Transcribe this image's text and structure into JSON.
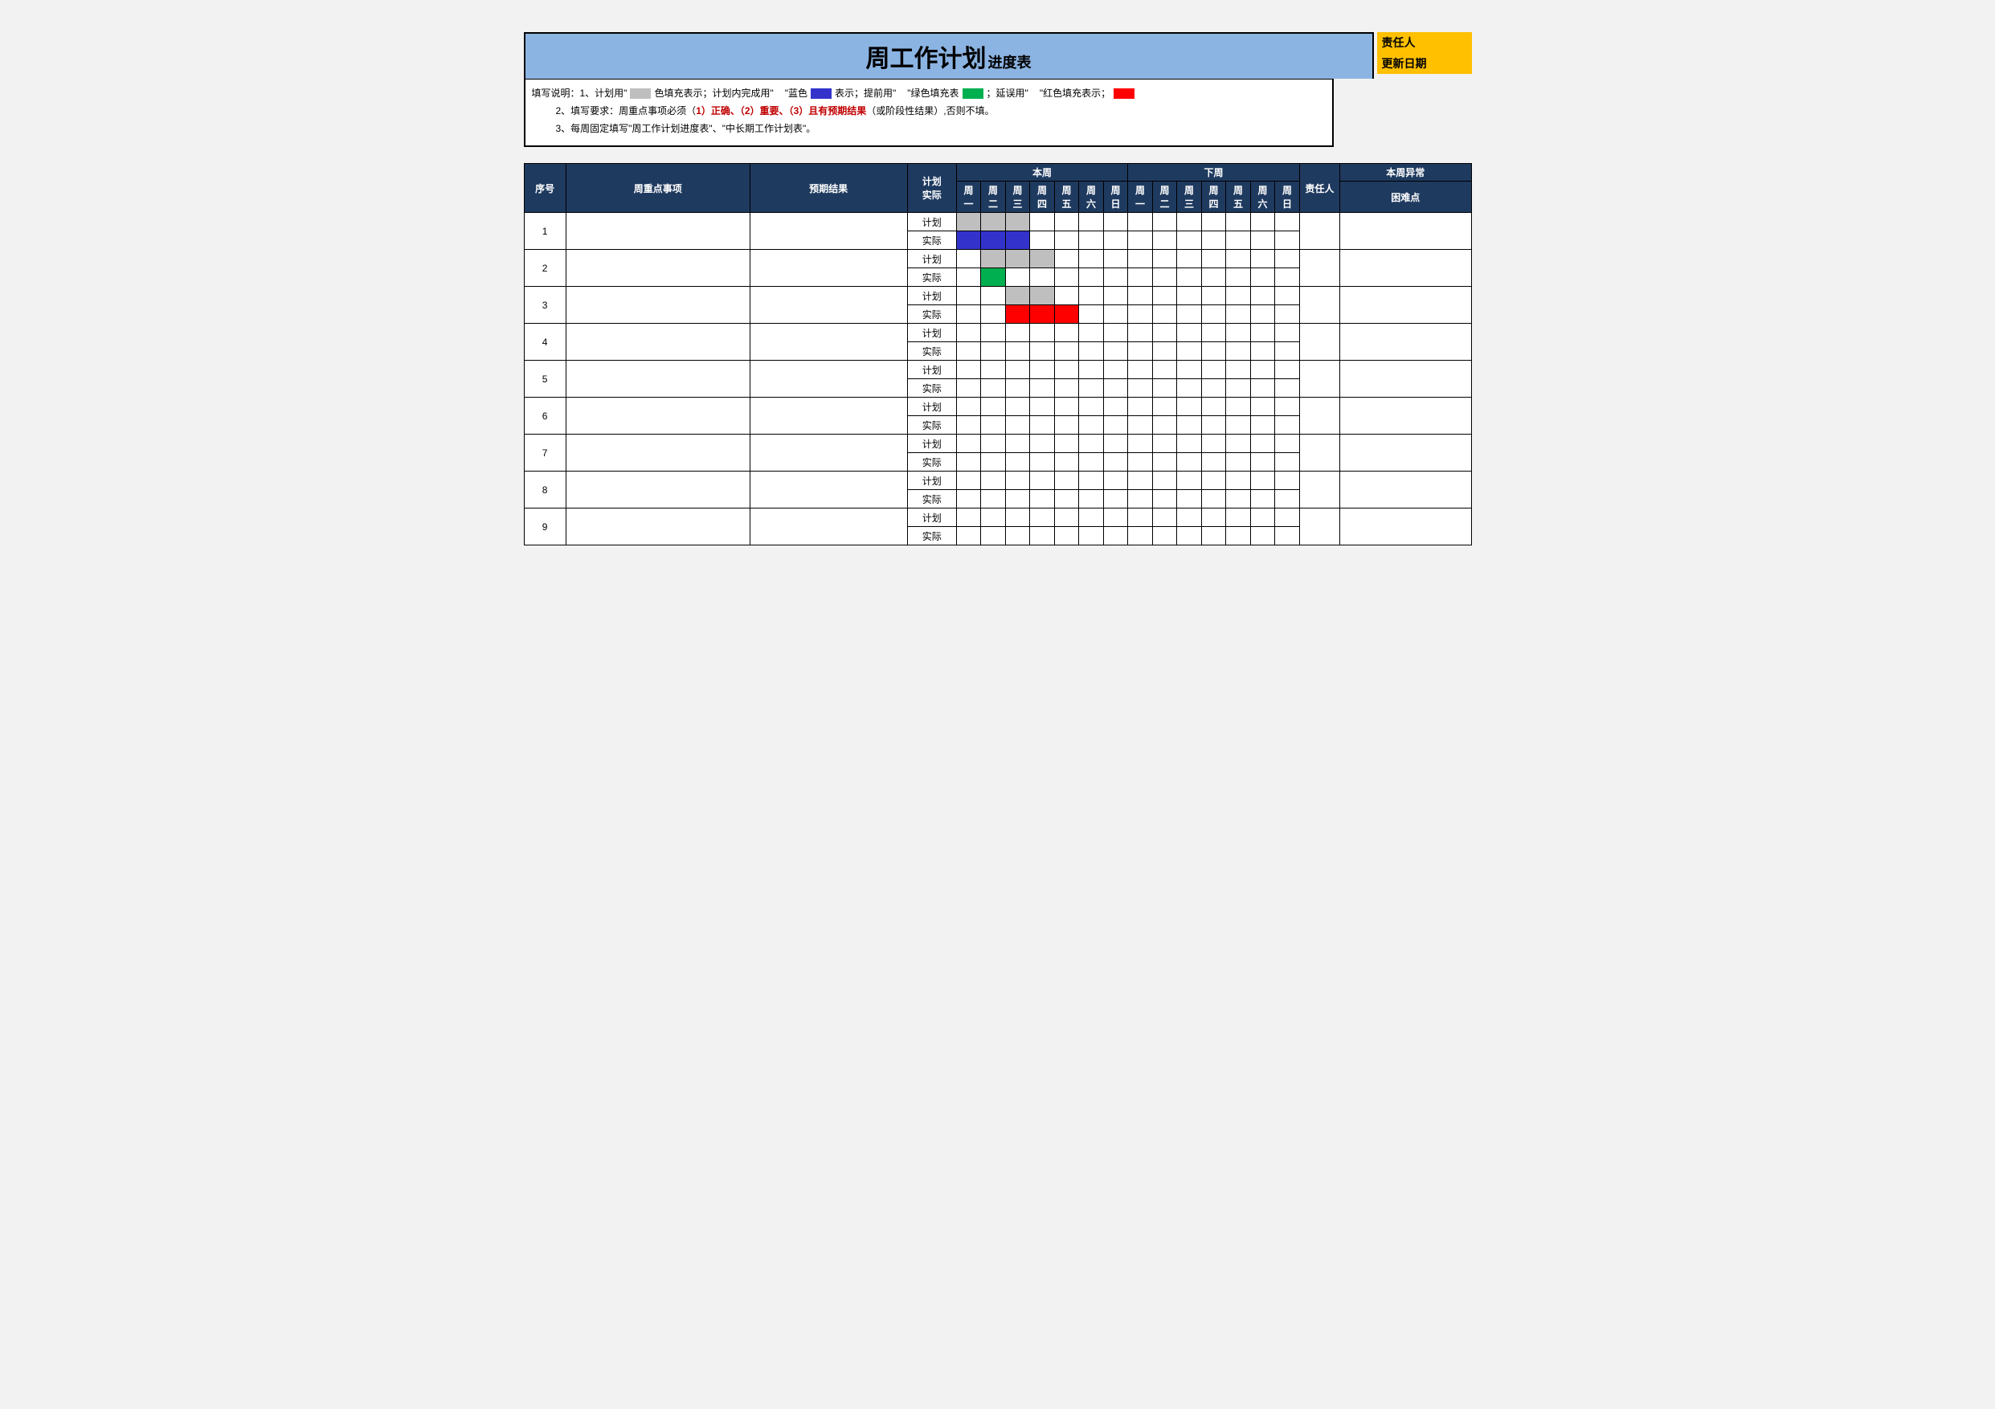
{
  "title": {
    "main": "周工作计划",
    "sub": "进度表"
  },
  "meta": {
    "owner_label": "责任人",
    "date_label": "更新日期"
  },
  "instructions": {
    "line1_prefix": "填写说明：1、计划用\"",
    "line1_a": "色填充表示；计划内完成用\"",
    "line1_b_pre": "\"蓝色",
    "line1_b_post": "表示；提前用\"",
    "line1_c_pre": "\"绿色填充表",
    "line1_c_post": "；延误用\"",
    "line1_d_pre": "\"红色填充表示；",
    "line2_plain_a": "2、填写要求：周重点事项必须（",
    "line2_r1": "1）正确、",
    "line2_r2": "（2）重要、",
    "line2_r3": "（3）且有预期结果",
    "line2_plain_b": "（或阶段性结果）,否则不填。",
    "line3": "3、每周固定填写\"周工作计划进度表\"、\"中长期工作计划表\"。"
  },
  "headers": {
    "seq": "序号",
    "item": "周重点事项",
    "expect": "预期结果",
    "plan_actual": "计划\n实际",
    "this_week": "本周",
    "next_week": "下周",
    "owner": "责任人",
    "abnormal": "本周异常",
    "difficulty": "困难点",
    "days": [
      "周一",
      "周二",
      "周三",
      "周四",
      "周五",
      "周六",
      "周日"
    ]
  },
  "row_labels": {
    "plan": "计划",
    "actual": "实际"
  },
  "rows": [
    {
      "seq": "1",
      "plan_fill": {
        "start": 0,
        "end": 2,
        "cls": "fill-gray"
      },
      "actual_fill": {
        "start": 0,
        "end": 2,
        "cls": "fill-blue"
      }
    },
    {
      "seq": "2",
      "plan_fill": {
        "start": 1,
        "end": 3,
        "cls": "fill-gray"
      },
      "actual_fill": {
        "start": 1,
        "end": 1,
        "cls": "fill-green"
      }
    },
    {
      "seq": "3",
      "plan_fill": {
        "start": 2,
        "end": 3,
        "cls": "fill-gray"
      },
      "actual_fill": {
        "start": 2,
        "end": 4,
        "cls": "fill-red"
      }
    },
    {
      "seq": "4"
    },
    {
      "seq": "5"
    },
    {
      "seq": "6"
    },
    {
      "seq": "7"
    },
    {
      "seq": "8"
    },
    {
      "seq": "9"
    }
  ]
}
